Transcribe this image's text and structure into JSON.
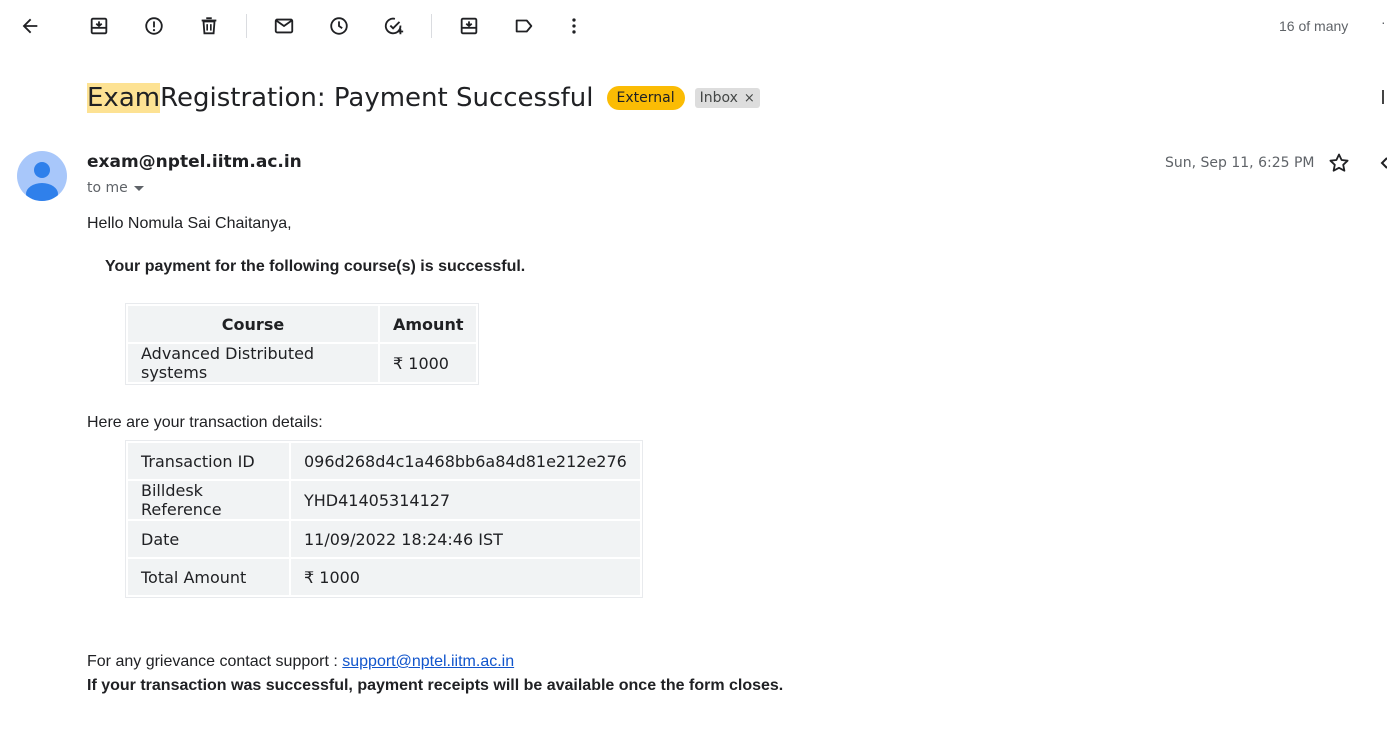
{
  "toolbar": {
    "page_count": "16 of many",
    "icons": [
      "back-arrow-icon",
      "archive-icon",
      "report-spam-icon",
      "delete-icon",
      "mark-unread-icon",
      "snooze-icon",
      "add-to-tasks-icon",
      "move-to-icon",
      "label-icon",
      "more-vert-icon"
    ]
  },
  "email": {
    "subject_highlight": "Exam",
    "subject_rest": " Registration: Payment Successful",
    "badge_external": "External",
    "label_inbox": "Inbox",
    "label_remove": "×",
    "sender": "exam@nptel.iitm.ac.in",
    "to": "to me",
    "date": "Sun, Sep 11, 6:25 PM"
  },
  "body": {
    "greeting": "Hello Nomula Sai Chaitanya,",
    "payment_line": "Your payment for the following course(s) is successful.",
    "course_table": {
      "headers": [
        "Course",
        "Amount"
      ],
      "rows": [
        [
          "Advanced Distributed systems",
          "₹ 1000"
        ]
      ]
    },
    "tx_intro": "Here are your transaction details:",
    "tx_table": {
      "rows": [
        [
          "Transaction ID",
          "096d268d4c1a468bb6a84d81e212e276"
        ],
        [
          "Billdesk Reference",
          "YHD41405314127"
        ],
        [
          "Date",
          "11/09/2022 18:24:46 IST"
        ],
        [
          "Total Amount",
          "₹ 1000"
        ]
      ]
    },
    "support_text": "For any grievance contact support : ",
    "support_email": "support@nptel.iitm.ac.in",
    "receipt_line": "If your transaction was successful, payment receipts will be available once the form closes."
  }
}
